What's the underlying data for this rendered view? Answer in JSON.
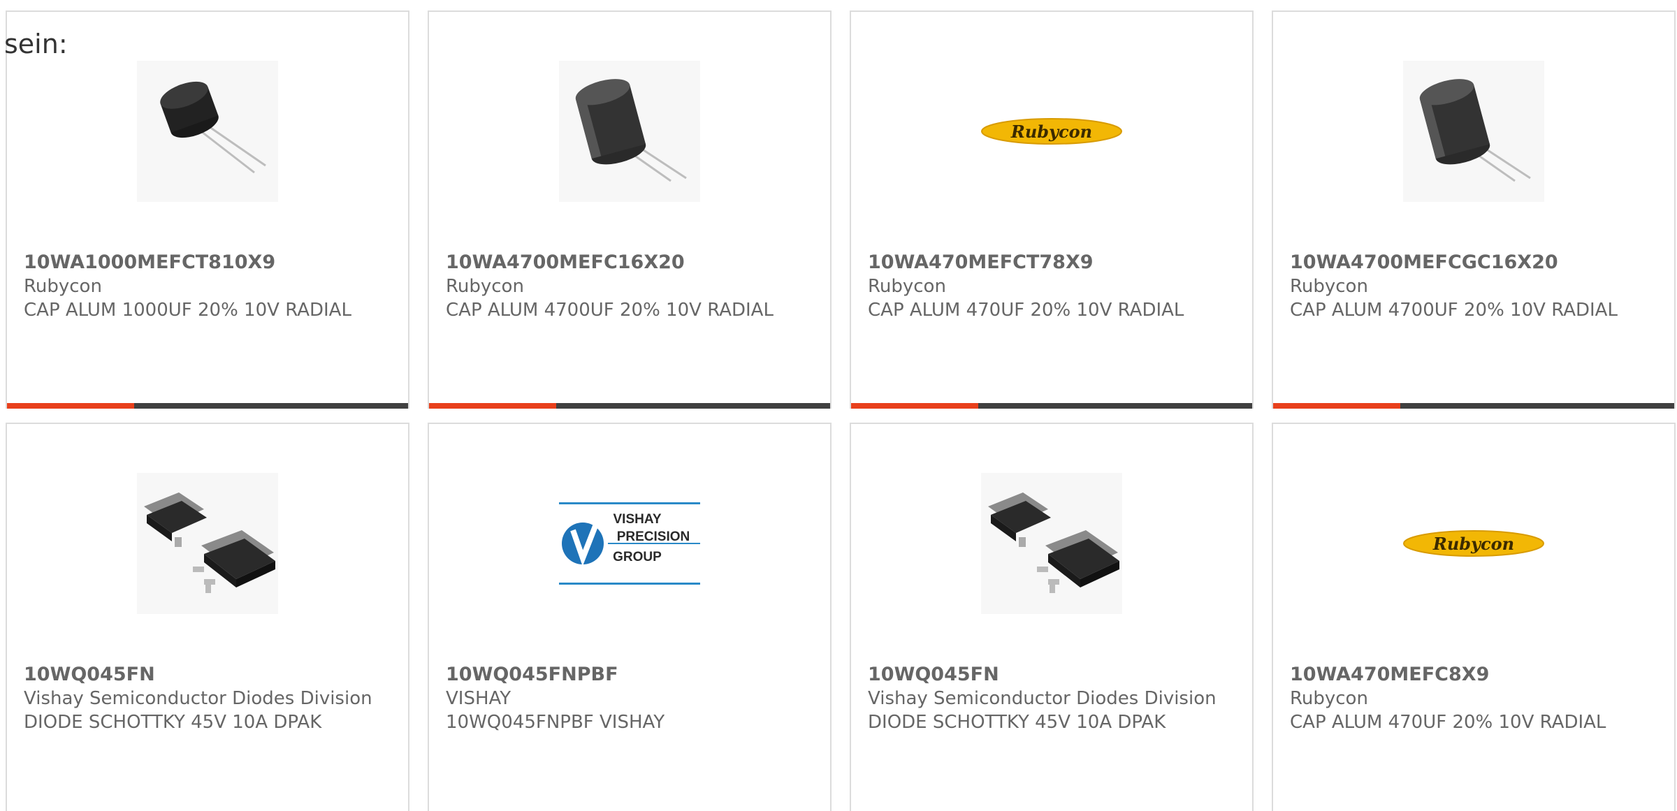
{
  "intro_text": "sein:",
  "colors": {
    "accent": "#e8401c",
    "bar": "#404040",
    "text": "#666666",
    "border": "#dcdcdc"
  },
  "products": [
    {
      "part": "10WA1000MEFCT810X9",
      "manufacturer": "Rubycon",
      "description": "CAP ALUM 1000UF 20% 10V RADIAL",
      "image": "capacitor-small-icon"
    },
    {
      "part": "10WA4700MEFC16X20",
      "manufacturer": "Rubycon",
      "description": "CAP ALUM 4700UF 20% 10V RADIAL",
      "image": "capacitor-large-icon"
    },
    {
      "part": "10WA470MEFCT78X9",
      "manufacturer": "Rubycon",
      "description": "CAP ALUM 470UF 20% 10V RADIAL",
      "image": "rubycon-logo"
    },
    {
      "part": "10WA4700MEFCGC16X20",
      "manufacturer": "Rubycon",
      "description": "CAP ALUM 4700UF 20% 10V RADIAL",
      "image": "capacitor-large-icon"
    },
    {
      "part": "10WQ045FN",
      "manufacturer": "Vishay Semiconductor Diodes Division",
      "description": "DIODE SCHOTTKY 45V 10A DPAK",
      "image": "dpak-diode-icon"
    },
    {
      "part": "10WQ045FNPBF",
      "manufacturer": "VISHAY",
      "description": "10WQ045FNPBF VISHAY",
      "image": "vishay-precision-logo",
      "logo_lines": [
        "VISHAY",
        "PRECISION",
        "GROUP"
      ]
    },
    {
      "part": "10WQ045FN",
      "manufacturer": "Vishay Semiconductor Diodes Division",
      "description": "DIODE SCHOTTKY 45V 10A DPAK",
      "image": "dpak-diode-icon"
    },
    {
      "part": "10WA470MEFC8X9",
      "manufacturer": "Rubycon",
      "description": "CAP ALUM 470UF 20% 10V RADIAL",
      "image": "rubycon-logo"
    }
  ],
  "rubycon_logo_text": "Rubycon"
}
